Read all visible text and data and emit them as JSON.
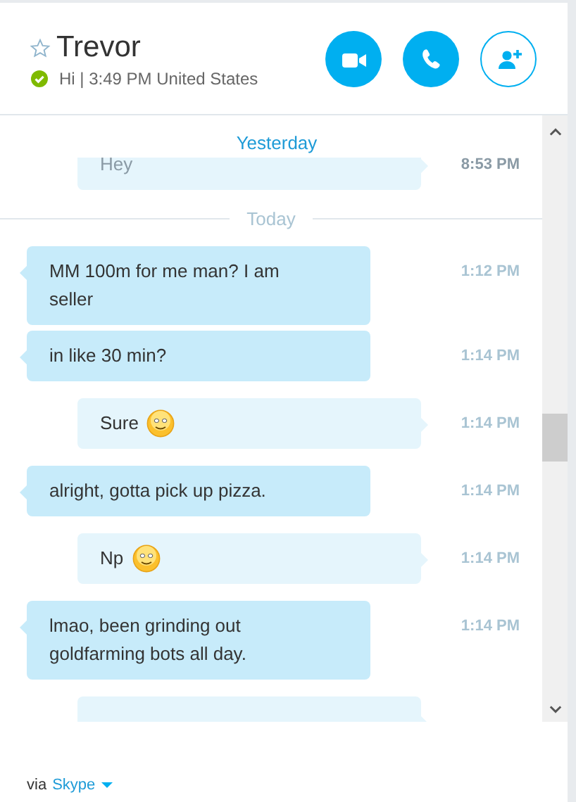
{
  "contact": {
    "name": "Trevor",
    "favorite": false,
    "status_line": "Hi | 3:49 PM United States"
  },
  "actions": [
    {
      "kind": "video"
    },
    {
      "kind": "call"
    },
    {
      "kind": "add-contact"
    }
  ],
  "conversation": [
    {
      "kind": "date",
      "label": "Yesterday"
    },
    {
      "kind": "outgoing",
      "text": "Hey",
      "time": "8:53 PM",
      "emoticon": false
    },
    {
      "kind": "divider",
      "label": "Today"
    },
    {
      "kind": "incoming",
      "text": "MM 100m for me man? I am seller",
      "time": "1:12 PM",
      "emoticon": false
    },
    {
      "kind": "incoming",
      "text": "in like 30 min?",
      "time": "1:14 PM",
      "emoticon": false
    },
    {
      "kind": "outgoing",
      "text": "Sure",
      "time": "1:14 PM",
      "emoticon": true
    },
    {
      "kind": "incoming",
      "text": "alright, gotta pick up pizza.",
      "time": "1:14 PM",
      "emoticon": false
    },
    {
      "kind": "outgoing",
      "text": "Np",
      "time": "1:14 PM",
      "emoticon": true
    },
    {
      "kind": "incoming",
      "text": "lmao, been grinding out goldfarming bots all day.",
      "time": "1:14 PM",
      "emoticon": false
    },
    {
      "kind": "outgoing",
      "emoticon": false
    }
  ],
  "footer": {
    "prefix": "via",
    "service": "Skype"
  }
}
